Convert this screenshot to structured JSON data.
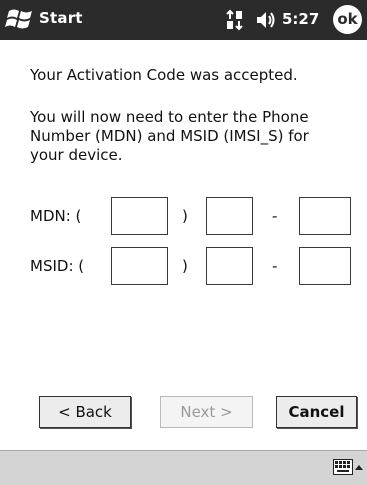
{
  "titlebar": {
    "start_label": "Start",
    "time": "5:27",
    "ok_label": "ok",
    "icons": [
      "windows-flag-icon",
      "network-icon",
      "volume-icon"
    ]
  },
  "message": {
    "line1": "Your Activation Code was accepted.",
    "line2": "You will now need to enter the Phone\nNumber (MDN) and MSID (IMSI_S) for\nyour device."
  },
  "fields": {
    "mdn": {
      "label": "MDN: (",
      "close_paren": ")",
      "dash": "-",
      "values": [
        "",
        "",
        ""
      ]
    },
    "msid": {
      "label": "MSID: (",
      "close_paren": ")",
      "dash": "-",
      "values": [
        "",
        "",
        ""
      ]
    }
  },
  "buttons": {
    "back": "< Back",
    "next": "Next >",
    "cancel": "Cancel"
  },
  "bottombar": {
    "icons": [
      "keyboard-icon",
      "input-menu-arrow-icon"
    ]
  },
  "colors": {
    "titlebar_bg": "#2b2b2b",
    "bottombar_bg": "#d4d4d4",
    "disabled_text": "#9a9a9a"
  }
}
